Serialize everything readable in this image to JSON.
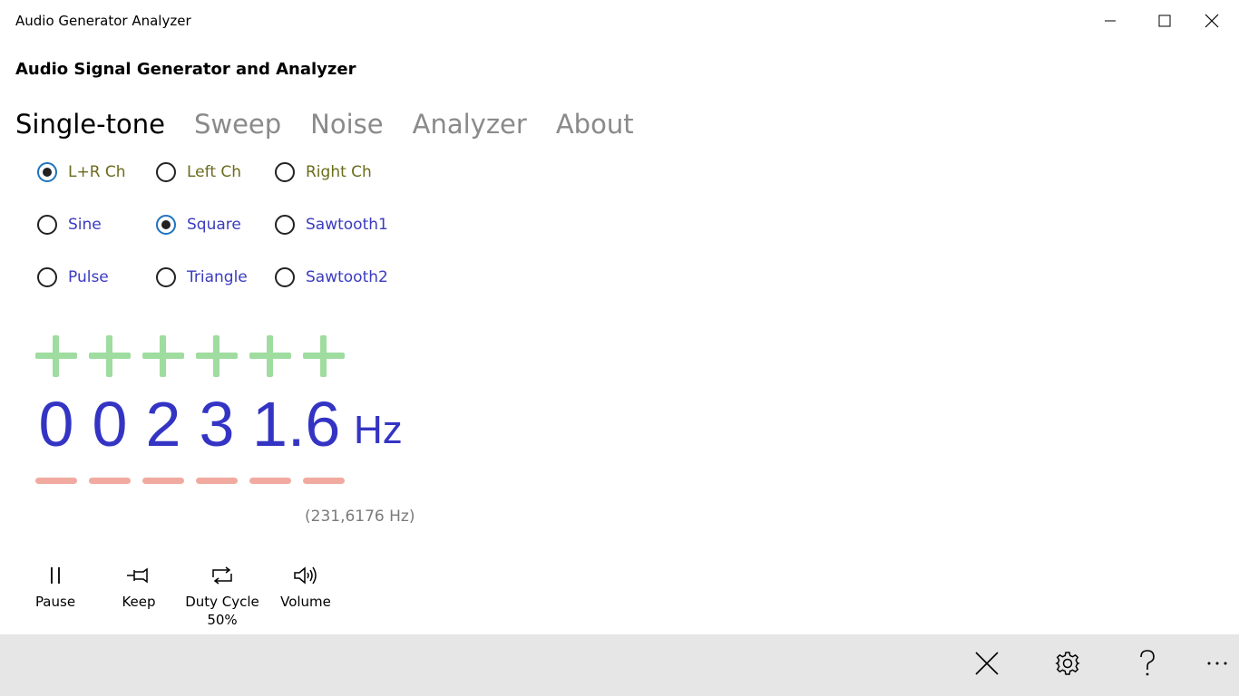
{
  "window": {
    "title": "Audio Generator Analyzer"
  },
  "app": {
    "title": "Audio Signal Generator and Analyzer"
  },
  "tabs": [
    {
      "label": "Single-tone",
      "active": true
    },
    {
      "label": "Sweep",
      "active": false
    },
    {
      "label": "Noise",
      "active": false
    },
    {
      "label": "Analyzer",
      "active": false
    },
    {
      "label": "About",
      "active": false
    }
  ],
  "channels": [
    {
      "label": "L+R Ch",
      "checked": true
    },
    {
      "label": "Left Ch",
      "checked": false
    },
    {
      "label": "Right Ch",
      "checked": false
    }
  ],
  "waveforms": [
    {
      "label": "Sine",
      "checked": false
    },
    {
      "label": "Square",
      "checked": true
    },
    {
      "label": "Sawtooth1",
      "checked": false
    },
    {
      "label": "Pulse",
      "checked": false
    },
    {
      "label": "Triangle",
      "checked": false
    },
    {
      "label": "Sawtooth2",
      "checked": false
    }
  ],
  "frequency": {
    "digits": [
      "0",
      "0",
      "2",
      "3",
      "1.6"
    ],
    "decimal_digit": "",
    "unit": "Hz",
    "exact": "(231,6176 Hz)"
  },
  "commands": {
    "pause": "Pause",
    "keep": "Keep",
    "duty_cycle": "Duty Cycle",
    "duty_value": "50%",
    "volume": "Volume"
  },
  "icons": {
    "minimize": "minimize-icon",
    "maximize": "maximize-icon",
    "close": "close-icon",
    "pause": "pause-icon",
    "keep": "pin-icon",
    "duty_cycle": "repeat-icon",
    "volume": "volume-icon",
    "appbar_close": "close-icon",
    "settings": "gear-icon",
    "help": "help-icon",
    "more": "more-icon"
  },
  "colors": {
    "digit_blue": "#3434c4",
    "plus_green": "#9fdc9f",
    "minus_red": "#f0aaa0",
    "channel_label": "#6b6b1c",
    "waveform_label": "#3b3bc0",
    "appbar_bg": "#e6e6e6"
  }
}
